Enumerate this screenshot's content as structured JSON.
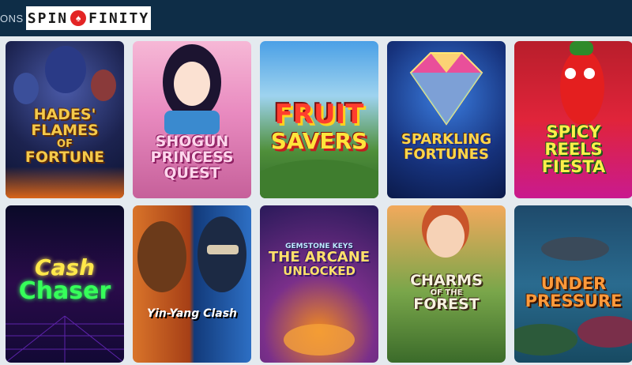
{
  "header": {
    "nav_fragment": "ONS",
    "logo_left": "SPIN",
    "logo_right": "FINITY",
    "logo_mark_icon": "spade-icon"
  },
  "games": [
    {
      "lines": [
        "Hades' Flames",
        "of",
        "Fortune"
      ]
    },
    {
      "lines": [
        "Shogun",
        "Princess",
        "Quest"
      ]
    },
    {
      "lines": [
        "Fruit",
        "Savers"
      ]
    },
    {
      "lines": [
        "Sparkling",
        "Fortunes"
      ]
    },
    {
      "lines": [
        "Spicy",
        "Reels",
        "Fiesta"
      ]
    },
    {
      "lines": [
        "Cash",
        "Chaser"
      ]
    },
    {
      "lines": [
        "Yin-Yang Clash"
      ]
    },
    {
      "lines": [
        "Gemstone Keys",
        "The Arcane",
        "Unlocked"
      ]
    },
    {
      "lines": [
        "Charms",
        "of the",
        "Forest"
      ]
    },
    {
      "lines": [
        "Under",
        "Pressure"
      ]
    }
  ],
  "colors": {
    "header_bg": "#0e2d47",
    "page_bg": "#e4eaef",
    "logo_accent": "#e32424"
  }
}
